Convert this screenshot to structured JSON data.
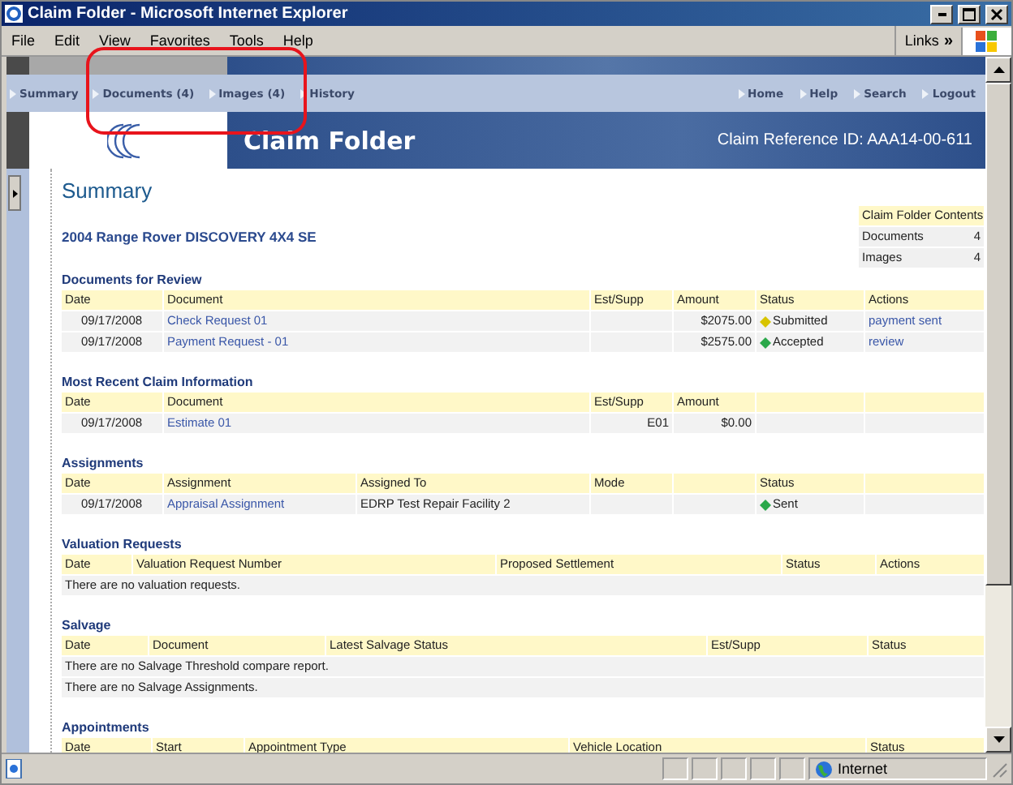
{
  "window": {
    "title": "Claim Folder - Microsoft Internet Explorer"
  },
  "menu": [
    "File",
    "Edit",
    "View",
    "Favorites",
    "Tools",
    "Help"
  ],
  "links": {
    "label": "Links",
    "chevron": "»"
  },
  "nav": {
    "left": [
      "Summary",
      "Documents (4)",
      "Images (4)",
      "History"
    ],
    "right": [
      "Home",
      "Help",
      "Search",
      "Logout"
    ]
  },
  "header": {
    "title": "Claim Folder",
    "reference": "Claim Reference ID: AAA14-00-611"
  },
  "page_title": "Summary",
  "vehicle": "2004 Range Rover DISCOVERY 4X4 SE",
  "contents": {
    "title": "Claim Folder Contents",
    "items": [
      {
        "label": "Documents",
        "count": "4"
      },
      {
        "label": "Images",
        "count": "4"
      }
    ]
  },
  "sections": [
    {
      "kind": "documents_review",
      "title": "Documents for Review",
      "columns": [
        "Date",
        "Document",
        "Est/Supp",
        "Amount",
        "Status",
        "Actions"
      ],
      "rows": [
        {
          "date": "09/17/2008",
          "document": "Check Request 01",
          "amount": "$2075.00",
          "status": {
            "label": "Submitted",
            "color": "#d8c400"
          },
          "action": "payment sent"
        },
        {
          "date": "09/17/2008",
          "document": "Payment Request - 01",
          "amount": "$2575.00",
          "status": {
            "label": "Accepted",
            "color": "#2aa84a"
          },
          "action": "review"
        }
      ]
    },
    {
      "kind": "recent_claim",
      "title": "Most Recent Claim Information",
      "columns": [
        "Date",
        "Document",
        "Est/Supp",
        "Amount"
      ],
      "rows": [
        {
          "date": "09/17/2008",
          "document": "Estimate 01",
          "est_supp": "E01",
          "amount": "$0.00"
        }
      ]
    },
    {
      "kind": "assignments",
      "title": "Assignments",
      "columns": [
        "Date",
        "Assignment",
        "Assigned To",
        "Mode",
        "Status"
      ],
      "rows": [
        {
          "date": "09/17/2008",
          "document": "Appraisal Assignment",
          "assigned_to": "EDRP Test Repair Facility 2",
          "status": {
            "label": "Sent",
            "color": "#2aa84a"
          }
        }
      ]
    },
    {
      "kind": "valuation",
      "title": "Valuation Requests",
      "columns": [
        "Date",
        "Valuation Request Number",
        "Proposed Settlement",
        "Status",
        "Actions"
      ],
      "messages": [
        "There are no valuation requests."
      ]
    },
    {
      "kind": "salvage",
      "title": "Salvage",
      "columns": [
        "Date",
        "Document",
        "Latest Salvage Status",
        "Est/Supp",
        "Status"
      ],
      "messages": [
        "There are no Salvage Threshold compare report.",
        "There are no Salvage Assignments."
      ]
    },
    {
      "kind": "appointments",
      "title": "Appointments",
      "columns": [
        "Date",
        "Start",
        "Appointment Type",
        "Vehicle Location",
        "Status"
      ]
    }
  ],
  "status_bar": {
    "zone": "Internet"
  }
}
